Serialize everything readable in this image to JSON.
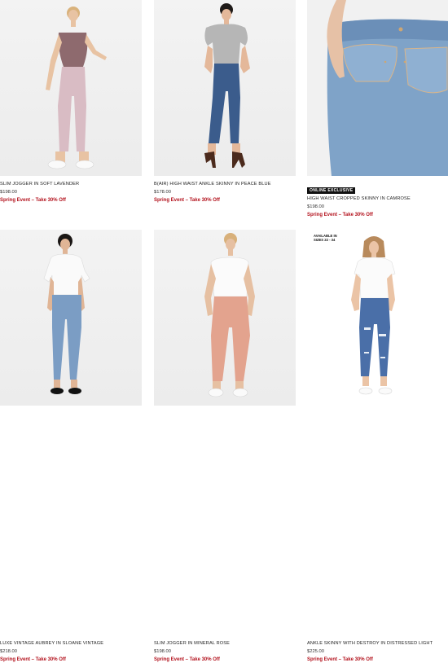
{
  "products": [
    {
      "name": "SLIM JOGGER IN SOFT LAVENDER",
      "price": "$198.00",
      "promo": "Spring Event – Take 30% Off",
      "badge": "",
      "sizes_tag": ""
    },
    {
      "name": "B(AIR) HIGH WAIST ANKLE SKINNY IN PEACE BLUE",
      "price": "$178.00",
      "promo": "Spring Event – Take 30% Off",
      "badge": "",
      "sizes_tag": ""
    },
    {
      "name": "HIGH WAIST CROPPED SKINNY IN CAMROSE",
      "price": "$198.00",
      "promo": "Spring Event – Take 30% Off",
      "badge": "ONLINE EXCLUSIVE",
      "sizes_tag": ""
    },
    {
      "name": "LUXE VINTAGE AUBREY IN SLOANE VINTAGE",
      "price": "$218.00",
      "promo": "Spring Event – Take 30% Off",
      "badge": "",
      "sizes_tag": ""
    },
    {
      "name": "SLIM JOGGER IN MINERAL ROSE",
      "price": "$198.00",
      "promo": "Spring Event – Take 30% Off",
      "badge": "",
      "sizes_tag": ""
    },
    {
      "name": "ANKLE SKINNY WITH DESTROY IN DISTRESSED LIGHT",
      "price": "$225.00",
      "promo": "Spring Event – Take 30% Off",
      "badge": "",
      "sizes_tag": "AVAILABLE IN SIZES 22 - 34"
    }
  ],
  "colors": {
    "promo": "#b3121d",
    "badge_bg": "#111111"
  }
}
